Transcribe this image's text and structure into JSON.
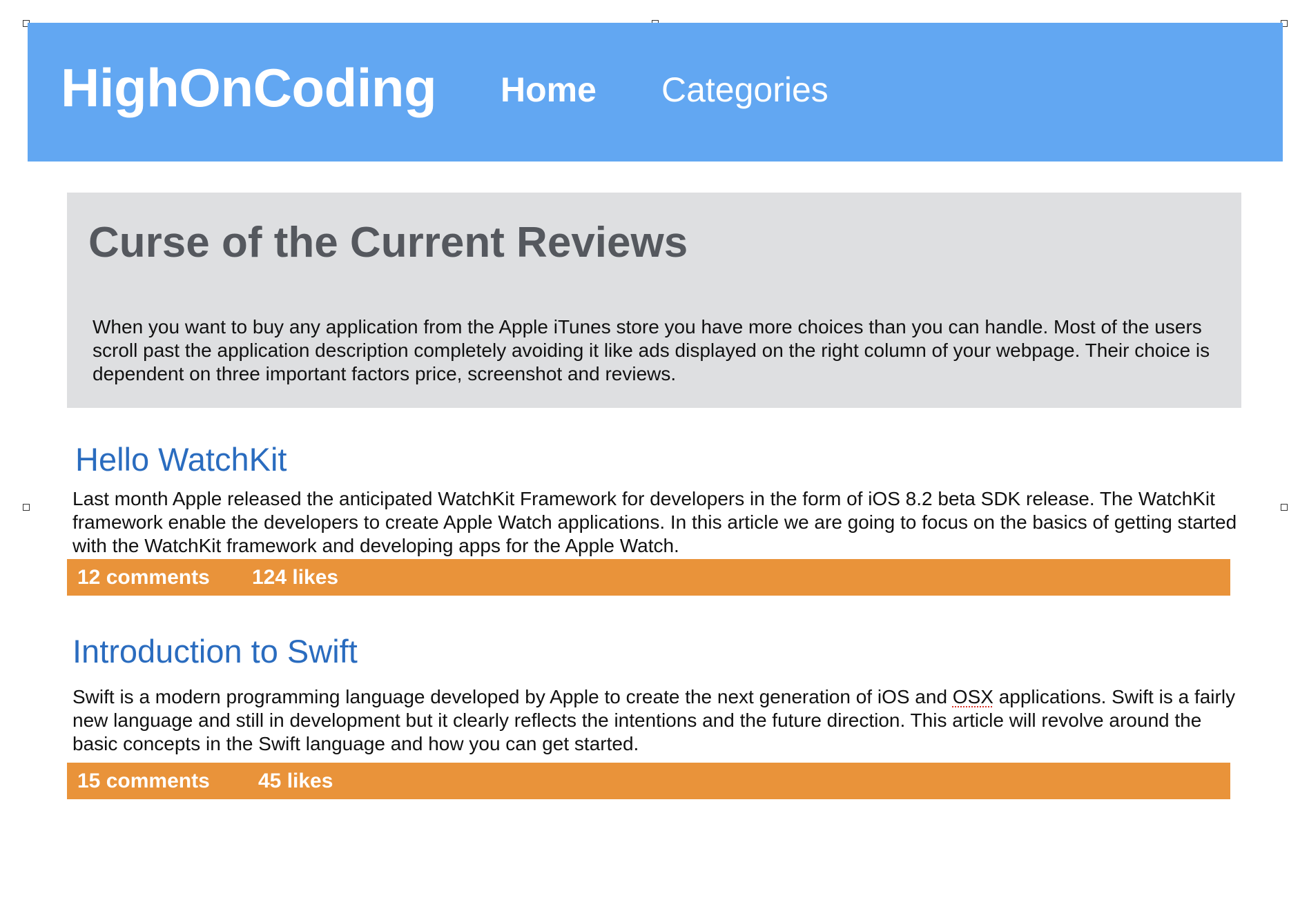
{
  "header": {
    "logo": "HighOnCoding",
    "nav": {
      "home": "Home",
      "categories": "Categories"
    }
  },
  "hero": {
    "title": "Curse of the Current Reviews",
    "text": "When you want to buy any application from the Apple iTunes store you have more choices than you can handle. Most of the users scroll past the application description completely avoiding it like ads displayed on the right column of your webpage. Their choice is dependent on three important factors price, screenshot and reviews."
  },
  "posts": [
    {
      "title": "Hello WatchKit",
      "body": "Last month Apple released the anticipated WatchKit Framework for developers in the form of iOS 8.2 beta SDK release. The WatchKit framework enable the developers to create Apple Watch applications. In this article we are going to focus on the basics of getting started with the WatchKit framework and developing apps for the Apple Watch.",
      "comments": "12 comments",
      "likes": "124 likes"
    },
    {
      "title": "Introduction to Swift",
      "body_before": "Swift is a modern programming language developed by Apple to create the next generation of iOS and ",
      "body_flagged": "OSX",
      "body_after": " applications. Swift is a fairly new language and still in development but it clearly reflects the intentions and the future direction. This article will revolve around the basic concepts in the Swift language and how you can get started.",
      "comments": "15 comments",
      "likes": "45 likes"
    }
  ],
  "colors": {
    "header_bg": "#62a7f2",
    "hero_bg": "#dedfe1",
    "hero_title": "#55585e",
    "post_title": "#2a6cbf",
    "stats_bg": "#e9933a",
    "spellcheck": "#d93025"
  }
}
